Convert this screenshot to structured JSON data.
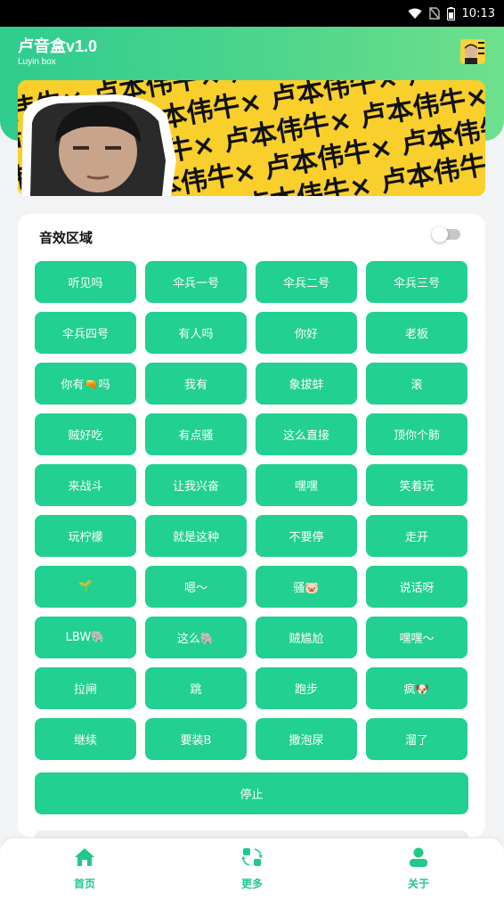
{
  "status_bar": {
    "time": "10:13",
    "icons": [
      "wifi-icon",
      "no-sim-icon",
      "battery-icon"
    ]
  },
  "app": {
    "title": "卢音盒v1.0",
    "subtitle": "Luyin box"
  },
  "banner": {
    "text": "卢本伟牛×"
  },
  "sound_section": {
    "title": "音效区域",
    "toggle_on": false,
    "buttons": [
      "听见吗",
      "伞兵一号",
      "伞兵二号",
      "伞兵三号",
      "伞兵四号",
      "有人吗",
      "你好",
      "老板",
      "你有🔫吗",
      "我有",
      "象拔蚌",
      "滚",
      "贼好吃",
      "有点骚",
      "这么直接",
      "顶你个肺",
      "来战斗",
      "让我兴奋",
      "嘿嘿",
      "笑着玩",
      "玩柠檬",
      "就是这种",
      "不要停",
      "走开",
      "🌱",
      "嗯～",
      "骚🐷",
      "说话呀",
      "LBW🐘",
      "这么🐘",
      "贼尴尬",
      "嘿嘿～",
      "拉闸",
      "跳",
      "跑步",
      "疯🐶",
      "继续",
      "要装B",
      "撒泡尿",
      "溜了"
    ],
    "stop_label": "停止"
  },
  "bottom_nav": {
    "items": [
      {
        "label": "首页",
        "icon": "home-icon"
      },
      {
        "label": "更多",
        "icon": "more-icon"
      },
      {
        "label": "关于",
        "icon": "user-icon"
      }
    ]
  },
  "colors": {
    "accent": "#22d091",
    "header_start": "#2ecc8e",
    "header_end": "#6fe08d",
    "banner_yellow": "#f9cf2c"
  }
}
